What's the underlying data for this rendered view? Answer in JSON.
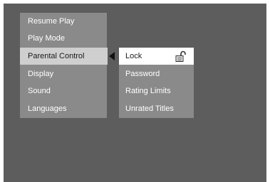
{
  "main_menu": {
    "items": [
      {
        "label": "Resume Play"
      },
      {
        "label": "Play Mode"
      },
      {
        "label": "Parental Control",
        "selected": true
      },
      {
        "label": "Display"
      },
      {
        "label": "Sound"
      },
      {
        "label": "Languages"
      }
    ]
  },
  "sub_menu": {
    "items": [
      {
        "label": "Lock",
        "selected": true,
        "icon": "padlock-open-icon"
      },
      {
        "label": "Password"
      },
      {
        "label": "Rating Limits"
      },
      {
        "label": "Unrated Titles"
      }
    ]
  },
  "colors": {
    "screen_background": "#5d5d5d",
    "menu_background": "#8a8a8a",
    "main_highlight": "#cfcfcf",
    "sub_highlight": "#ffffff",
    "text": "#ffffff",
    "selected_text": "#1a1a1a"
  }
}
